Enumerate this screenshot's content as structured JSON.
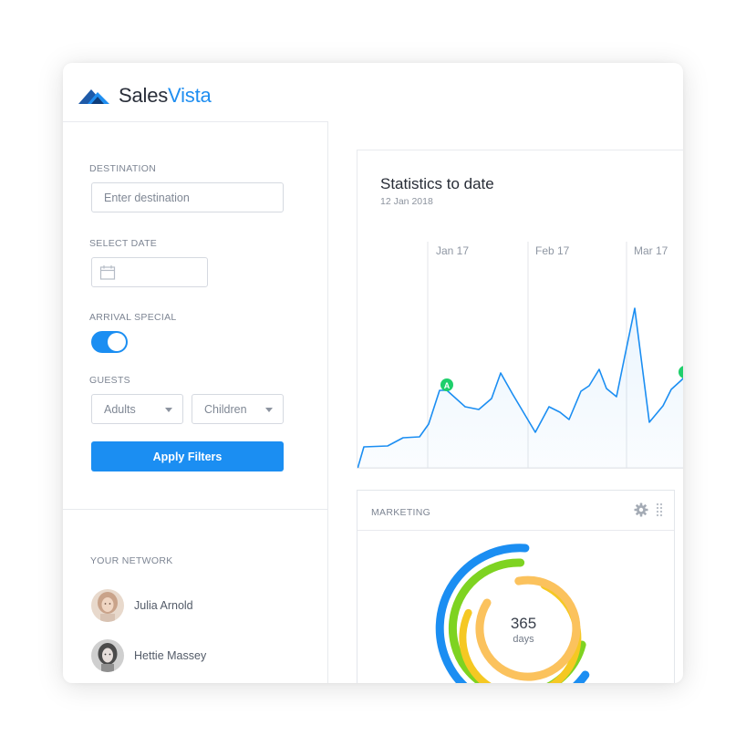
{
  "brand": {
    "name_part1": "Sales",
    "name_part2": "Vista",
    "accent_color": "#1f8ef0"
  },
  "filters": {
    "destination_label": "DESTINATION",
    "destination_placeholder": "Enter destination",
    "date_label": "SELECT DATE",
    "date_icon": "calendar-icon",
    "arrival_label": "ARRIVAL SPECIAL",
    "arrival_on": true,
    "guests_label": "GUESTS",
    "adults_value": "Adults",
    "children_value": "Children",
    "apply_label": "Apply Filters"
  },
  "network": {
    "label": "YOUR NETWORK",
    "people": [
      {
        "name": "Julia Arnold"
      },
      {
        "name": "Hettie Massey"
      }
    ]
  },
  "statistics": {
    "title": "Statistics to date",
    "date": "12 Jan 2018",
    "months": [
      "Jan 17",
      "Feb 17",
      "Mar 17"
    ],
    "marker_label": "A",
    "line_color": "#1b8ef2",
    "marker_color": "#1fcf6b"
  },
  "marketing": {
    "title": "MARKETING",
    "value": "365",
    "unit": "days",
    "ring_colors": [
      "#1b8ef2",
      "#7ed321",
      "#f5c823",
      "#fbc25d"
    ]
  }
}
